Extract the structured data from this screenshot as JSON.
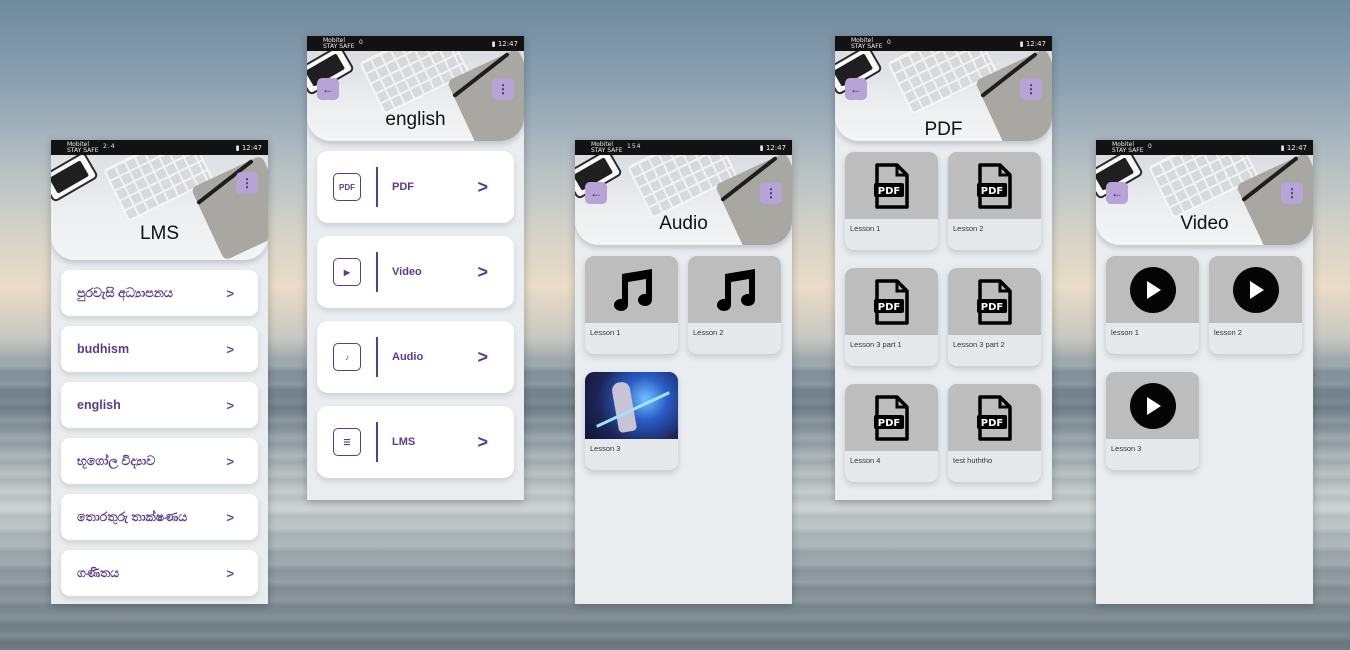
{
  "status": {
    "carrier1": "Mobitel",
    "carrier2": "STAY SAFE",
    "time": "12:47",
    "speed_lms": "2.4",
    "speed_audio": "154",
    "speed_other": "0",
    "speed_unit": "K/s",
    "battery": "85"
  },
  "lms": {
    "title": "LMS",
    "items": [
      "පුරවැසි අධ්‍යාපනය",
      "budhism",
      "english",
      "භූගෝල විද්‍යාව",
      "තොරතුරු තාක්ෂණය",
      "ගණිතය"
    ]
  },
  "english": {
    "title": "english",
    "items": [
      {
        "label": "PDF",
        "icon": "pdf-icon"
      },
      {
        "label": "Video",
        "icon": "video-icon"
      },
      {
        "label": "Audio",
        "icon": "audio-icon"
      },
      {
        "label": "LMS",
        "icon": "lms-icon"
      }
    ]
  },
  "audio": {
    "title": "Audio",
    "items": [
      "Lesson 1",
      "Lesson 2",
      "Lesson 3"
    ]
  },
  "pdf": {
    "title": "PDF",
    "icon_text": "PDF",
    "items": [
      "Lesson 1",
      "Lesson 2",
      "Lesson 3 part 1",
      "Lesson 3 part 2",
      "Lesson 4",
      "test huththo"
    ]
  },
  "video": {
    "title": "Video",
    "items": [
      "lesson 1",
      "lesson 2",
      "Lesson 3"
    ]
  },
  "colors": {
    "accent": "#5b3b8e",
    "button_bg": "#b6a4d6",
    "thumb_bg": "#bdbdbd"
  }
}
